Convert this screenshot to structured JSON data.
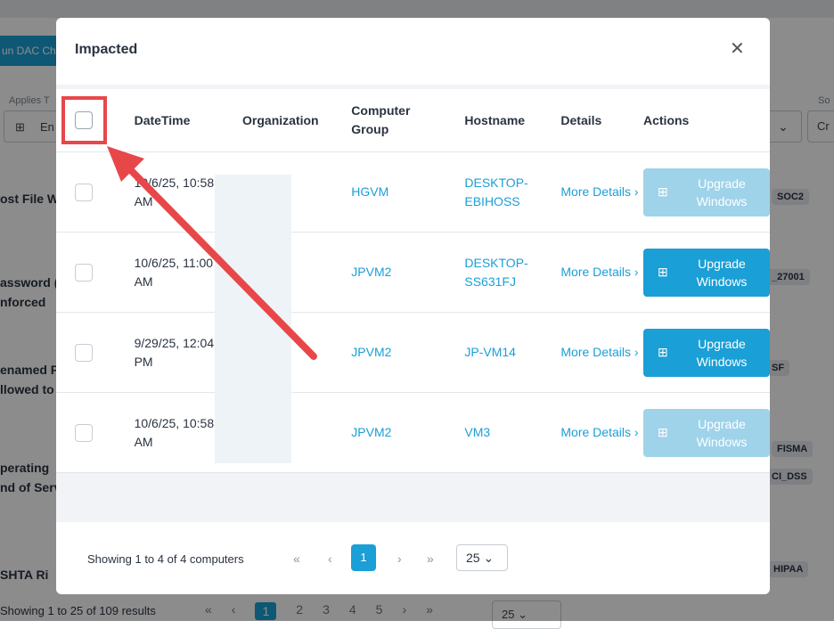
{
  "background": {
    "run_button": "un DAC Ch",
    "applies_label": "Applies T",
    "applies_value": "En",
    "so_label": "So",
    "right_select_value": "Cr",
    "rows": [
      {
        "lines": [
          "ost File W"
        ],
        "tags": [
          "SOC2"
        ]
      },
      {
        "lines": [
          "assword (",
          "nforced"
        ],
        "tags": [
          "_27001"
        ]
      },
      {
        "lines": [
          "enamed F",
          "llowed to"
        ],
        "tags": [
          "SF"
        ]
      },
      {
        "lines": [
          "perating",
          "nd of Serv"
        ],
        "tags": [
          "FISMA",
          "CI_DSS"
        ]
      },
      {
        "lines": [
          "SHTA Ri"
        ],
        "tags": [
          "HIPAA"
        ]
      }
    ],
    "footer": "Showing 1 to 25 of 109 results",
    "pages": [
      "1",
      "2",
      "3",
      "4",
      "5"
    ],
    "page_size": "25"
  },
  "modal": {
    "title": "Impacted",
    "close_icon": "close-icon",
    "columns": [
      "DateTime",
      "Organization",
      "Computer Group",
      "Hostname",
      "Details",
      "Actions"
    ],
    "rows": [
      {
        "datetime": "10/6/25, 10:58 AM",
        "organization": "",
        "group": "HGVM",
        "hostname": "DESKTOP-EBIHOSS",
        "details": "More Details",
        "action": "Upgrade Windows",
        "action_enabled": false
      },
      {
        "datetime": "10/6/25, 11:00 AM",
        "organization": "",
        "group": "JPVM2",
        "hostname": "DESKTOP-SS631FJ",
        "details": "More Details",
        "action": "Upgrade Windows",
        "action_enabled": true
      },
      {
        "datetime": "9/29/25, 12:04 PM",
        "organization": "",
        "group": "JPVM2",
        "hostname": "JP-VM14",
        "details": "More Details",
        "action": "Upgrade Windows",
        "action_enabled": true
      },
      {
        "datetime": "10/6/25, 10:58 AM",
        "organization": "",
        "group": "JPVM2",
        "hostname": "VM3",
        "details": "More Details",
        "action": "Upgrade Windows",
        "action_enabled": false
      }
    ],
    "footer": {
      "showing": "Showing 1 to 4 of 4 computers",
      "current_page": "1",
      "page_size": "25"
    }
  },
  "colors": {
    "accent": "#1a9fd6",
    "annotation": "#e8474a"
  }
}
